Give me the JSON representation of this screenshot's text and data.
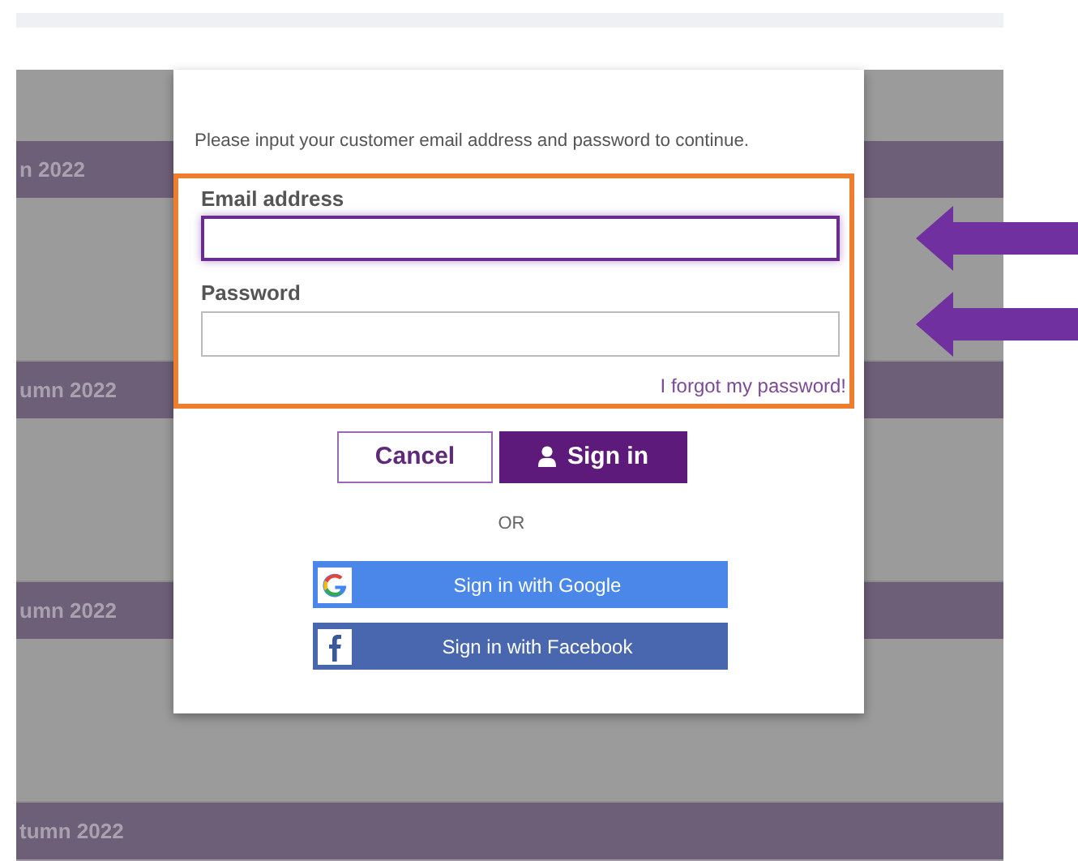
{
  "background_sections": [
    {
      "title": "n 2022"
    },
    {
      "title": "umn 2022"
    },
    {
      "title": "umn 2022"
    },
    {
      "title": "tumn 2022"
    }
  ],
  "dialog": {
    "instruction": "Please input your customer email address and password to continue.",
    "fields": [
      {
        "label": "Email address",
        "focused": true
      },
      {
        "label": "Password",
        "focused": false
      }
    ],
    "forgot_link": "I forgot my password!",
    "buttons": [
      {
        "label": "Cancel",
        "kind": "secondary"
      },
      {
        "label": "Sign in",
        "kind": "primary"
      }
    ],
    "separator": "OR",
    "social_buttons": [
      {
        "label": "Sign in with Google",
        "kind": "google"
      },
      {
        "label": "Sign in with Facebook",
        "kind": "facebook"
      }
    ]
  },
  "annotations": [
    {
      "kind": "arrow"
    },
    {
      "kind": "arrow"
    }
  ]
}
